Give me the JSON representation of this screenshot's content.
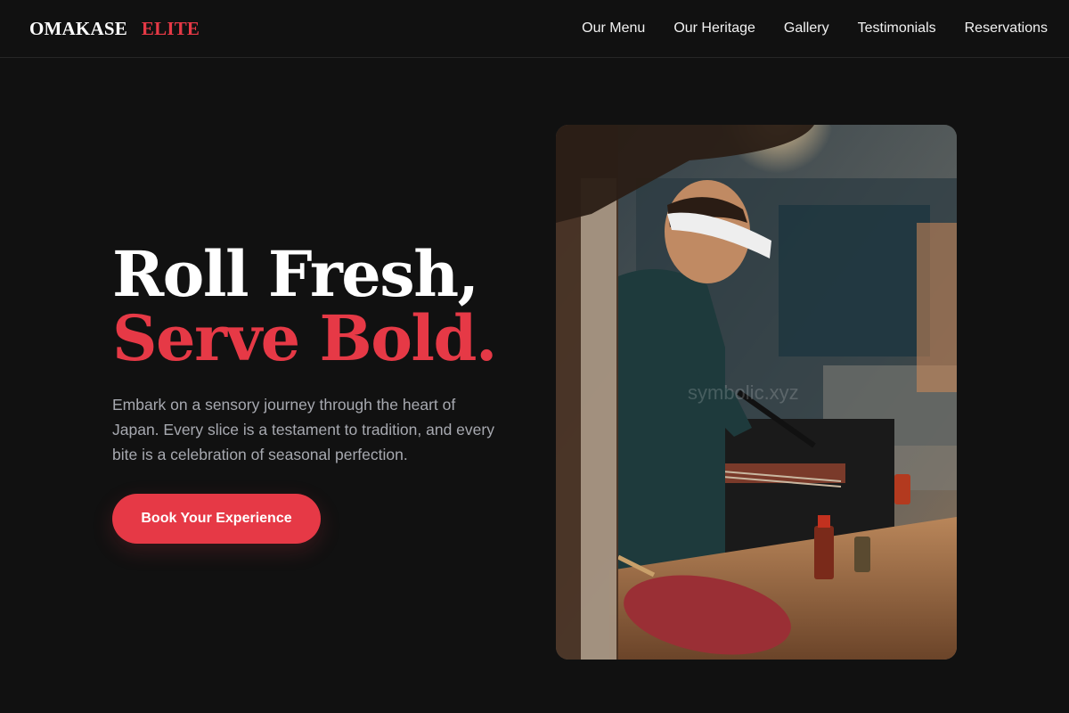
{
  "brand": {
    "part1": "OMAKASE",
    "part2": "ELITE"
  },
  "nav": {
    "items": [
      "Our Menu",
      "Our Heritage",
      "Gallery",
      "Testimonials",
      "Reservations"
    ]
  },
  "hero": {
    "headline_line1": "Roll Fresh,",
    "headline_line2": "Serve Bold.",
    "description": "Embark on a sensory journey through the heart of Japan. Every slice is a testament to tradition, and every bite is a celebration of seasonal perfection.",
    "cta_label": "Book Your Experience"
  },
  "image": {
    "watermark": "symbolic.xyz"
  },
  "colors": {
    "accent": "#e63946",
    "background": "#111111",
    "text": "#ffffff",
    "muted": "#a7a9b0"
  }
}
